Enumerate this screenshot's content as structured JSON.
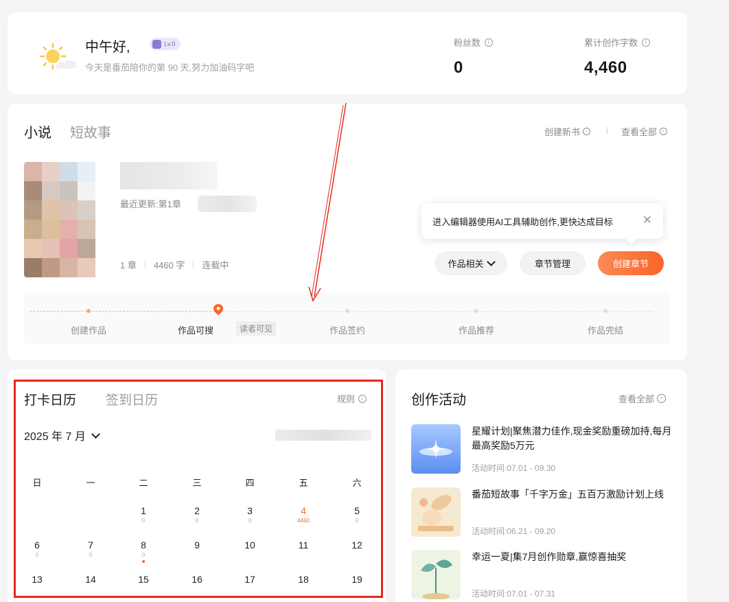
{
  "header": {
    "greeting": "中午好,",
    "level": "Lv.0",
    "subtitle": "今天是番茄陪你的第 90 天,努力加油码字吧",
    "stats": [
      {
        "label": "粉丝数",
        "value": "0"
      },
      {
        "label": "累计创作字数",
        "value": "4,460"
      }
    ]
  },
  "works": {
    "tabs": [
      "小说",
      "短故事"
    ],
    "create_book": "创建新书",
    "view_all": "查看全部",
    "latest_update": "最近更新:第1章",
    "chapters": "1 章",
    "words": "4460 字",
    "status": "连载中",
    "tooltip": "进入编辑器使用AI工具辅助创作,更快达成目标",
    "buttons": {
      "related": "作品相关",
      "manage": "章节管理",
      "create": "创建章节"
    },
    "progress": {
      "steps": [
        "创建作品",
        "作品可搜",
        "作品签约",
        "作品推荐",
        "作品完结"
      ],
      "current_index": 1,
      "current_tag": "读者可见"
    }
  },
  "calendar": {
    "tabs": [
      "打卡日历",
      "签到日历"
    ],
    "rules": "规则",
    "month": "2025 年 7 月",
    "weekdays": [
      "日",
      "一",
      "二",
      "三",
      "四",
      "五",
      "六"
    ],
    "weeks": [
      [
        null,
        null,
        {
          "d": "1",
          "c": "0"
        },
        {
          "d": "2",
          "c": "0"
        },
        {
          "d": "3",
          "c": "0"
        },
        {
          "d": "4",
          "c": "4460",
          "hl": true
        },
        {
          "d": "5",
          "c": "0"
        }
      ],
      [
        {
          "d": "6",
          "c": "0"
        },
        {
          "d": "7",
          "c": "0"
        },
        {
          "d": "8",
          "c": "0",
          "today": true
        },
        {
          "d": "9"
        },
        {
          "d": "10"
        },
        {
          "d": "11"
        },
        {
          "d": "12"
        }
      ],
      [
        {
          "d": "13"
        },
        {
          "d": "14"
        },
        {
          "d": "15"
        },
        {
          "d": "16"
        },
        {
          "d": "17"
        },
        {
          "d": "18"
        },
        {
          "d": "19"
        }
      ]
    ],
    "colors": {
      "highlight": "#f06b22",
      "frame": "#e8261c"
    }
  },
  "activities": {
    "title": "创作活动",
    "view_all": "查看全部",
    "items": [
      {
        "name": "星耀计划|聚焦潜力佳作,现金奖励重磅加持,每月最高奖励5万元",
        "time": "活动时间:07.01 - 09.30"
      },
      {
        "name": "番茄短故事「千字万金」五百万激励计划上线",
        "time": "活动时间:06.21 - 09.20"
      },
      {
        "name": "幸运一夏|集7月创作勋章,赢惊喜抽奖",
        "time": "活动时间:07.01 - 07.31"
      }
    ]
  },
  "theme": {
    "accent": "#f96525",
    "bg": "#f4f4f6"
  }
}
